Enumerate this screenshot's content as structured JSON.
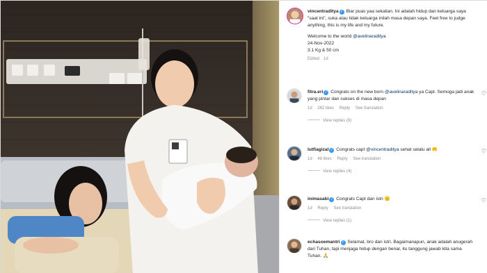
{
  "post": {
    "author": "vincentraditya",
    "caption_main": "Biar puas yaa sekalian. Ini adalah hidup dan keluarga saya \"saat ini\", suka atau tidak keluarga inilah masa depan saya. Feel free to judge anything, this is my life and my future.",
    "welcome_prefix": "Welcome to the world ",
    "welcome_mention": "@avelinaraditya",
    "date": "24-Nov-2022",
    "stats": "3.1 Kg & 50 cm",
    "edited": "Edited",
    "time": "1d"
  },
  "comments": [
    {
      "user": "fitra.eri",
      "text_before": "Congrats on the new born ",
      "mention": "@avelinaraditya",
      "text_after": " ya Capt. Semoga jadi anak yang pintar dan sukses di masa depan",
      "time": "1d",
      "likes": "262 likes",
      "reply": "Reply",
      "see_translation": "See translation",
      "view_replies": "View replies (9)"
    },
    {
      "user": "lutfiagizal",
      "text_before": "Congrats capt ",
      "mention": "@vincentraditya",
      "text_after": " sehat selalu all 🤲",
      "time": "1d",
      "likes": "48 likes",
      "reply": "Reply",
      "see_translation": "See translation",
      "view_replies": "View replies (4)"
    },
    {
      "user": "inimasabi",
      "text_before": "Congrats Capt dan istri 🫡",
      "mention": "",
      "text_after": "",
      "time": "1d",
      "likes": "",
      "reply": "Reply",
      "see_translation": "See translation",
      "view_replies": "View replies (1)"
    },
    {
      "user": "echasoemantri",
      "text_before": "Selamat, bro dan istri. Bagaimanapun, anak adalah anugerah dari Tuhan, tapi menjaga hidup dengan benar, itu tanggung jawab kita sama Tuhan. 🙏",
      "mention": "",
      "text_after": "",
      "time": "",
      "likes": "",
      "reply": "",
      "see_translation": "",
      "view_replies": ""
    }
  ],
  "icons": {
    "verified": "✓",
    "heart": "♡"
  },
  "colors": {
    "verified_blue": "#3897f0",
    "mention_blue": "#00376b",
    "muted_text": "#8e8e8e"
  }
}
